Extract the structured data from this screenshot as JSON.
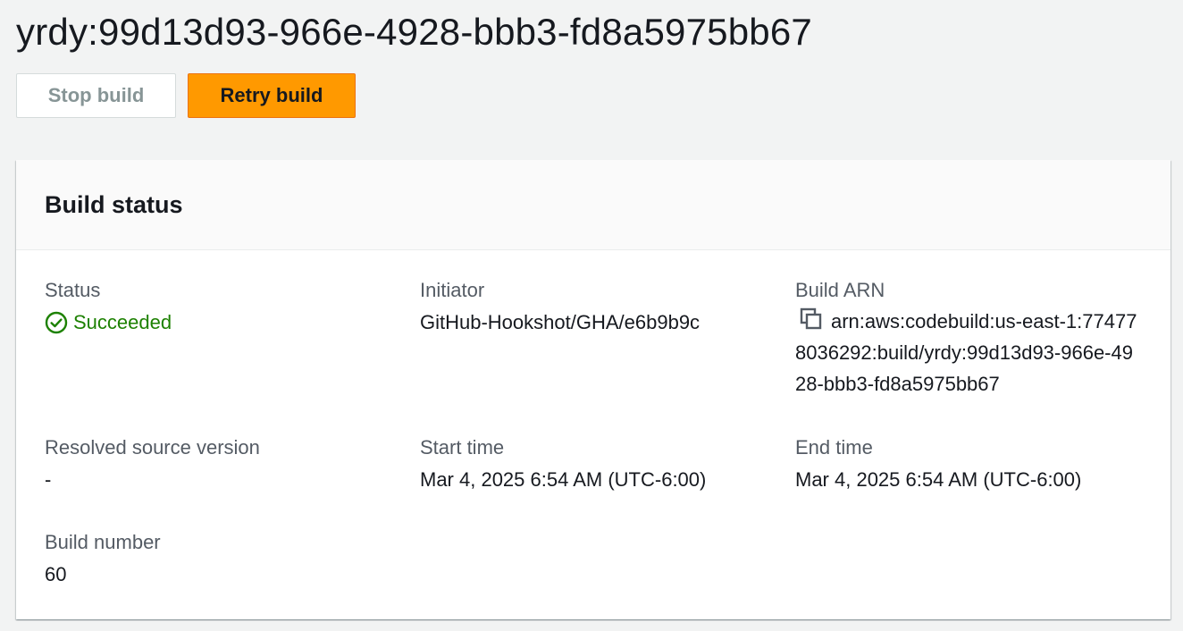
{
  "page": {
    "title": "yrdy:99d13d93-966e-4928-bbb3-fd8a5975bb67"
  },
  "actions": {
    "stop_label": "Stop build",
    "retry_label": "Retry build"
  },
  "panel": {
    "title": "Build status",
    "fields": {
      "status": {
        "label": "Status",
        "value": "Succeeded",
        "icon": "check-circle-icon",
        "color": "#1d8102"
      },
      "initiator": {
        "label": "Initiator",
        "value": "GitHub-Hookshot/GHA/e6b9b9c"
      },
      "build_arn": {
        "label": "Build ARN",
        "value": "arn:aws:codebuild:us-east-1:774778036292:build/yrdy:99d13d93-966e-4928-bbb3-fd8a5975bb67",
        "icon": "copy-icon"
      },
      "resolved_source_version": {
        "label": "Resolved source version",
        "value": "-"
      },
      "start_time": {
        "label": "Start time",
        "value": "Mar 4, 2025 6:54 AM (UTC-6:00)"
      },
      "end_time": {
        "label": "End time",
        "value": "Mar 4, 2025 6:54 AM (UTC-6:00)"
      },
      "build_number": {
        "label": "Build number",
        "value": "60"
      }
    }
  },
  "colors": {
    "accent": "#ff9900",
    "success": "#1d8102",
    "background": "#f2f3f3"
  }
}
